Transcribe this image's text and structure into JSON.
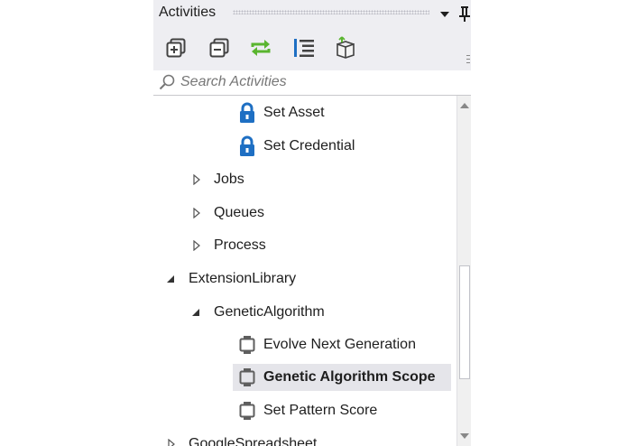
{
  "panel": {
    "title": "Activities"
  },
  "toolbar": {
    "buttons": [
      {
        "name": "expand-all-icon"
      },
      {
        "name": "collapse-all-icon"
      },
      {
        "name": "refresh-icon"
      },
      {
        "name": "show-list-icon"
      },
      {
        "name": "package-icon"
      }
    ]
  },
  "search": {
    "placeholder": "Search Activities",
    "value": ""
  },
  "tree": {
    "items": [
      {
        "label": "Set Asset",
        "icon": "lock-icon",
        "level": "activity"
      },
      {
        "label": "Set Credential",
        "icon": "lock-icon",
        "level": "activity"
      },
      {
        "label": "Jobs",
        "icon": "collapsed-arrow",
        "level": "group"
      },
      {
        "label": "Queues",
        "icon": "collapsed-arrow",
        "level": "group"
      },
      {
        "label": "Process",
        "icon": "collapsed-arrow",
        "level": "group"
      },
      {
        "label": "ExtensionLibrary",
        "icon": "expanded-arrow",
        "level": "root"
      },
      {
        "label": "GeneticAlgorithm",
        "icon": "expanded-arrow",
        "level": "group"
      },
      {
        "label": "Evolve Next Generation",
        "icon": "activity-icon",
        "level": "activity"
      },
      {
        "label": "Genetic Algorithm Scope",
        "icon": "activity-icon",
        "level": "activity",
        "selected": true
      },
      {
        "label": "Set Pattern Score",
        "icon": "activity-icon",
        "level": "activity"
      },
      {
        "label": "GoogleSpreadsheet",
        "icon": "collapsed-arrow",
        "level": "root"
      }
    ]
  },
  "colors": {
    "accent_green": "#5ab52f",
    "accent_blue": "#1e6fc3",
    "header_bg": "#eeeef2",
    "selected_bg": "#e5e5ea"
  }
}
